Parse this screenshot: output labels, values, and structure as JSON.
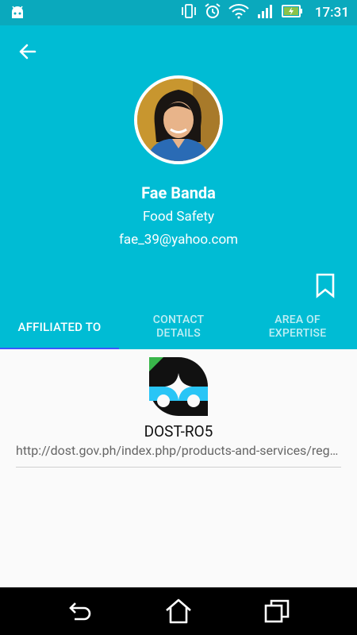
{
  "status_bar": {
    "time": "17:31",
    "icons": [
      "android-icon",
      "vibrate-icon",
      "alarm-icon",
      "wifi-icon",
      "signal-icon",
      "battery-charging-icon"
    ]
  },
  "profile": {
    "name": "Fae Banda",
    "department": "Food Safety",
    "email": "fae_39@yahoo.com"
  },
  "tabs": [
    {
      "label": "AFFILIATED TO",
      "active": true
    },
    {
      "label": "CONTACT\nDETAILS",
      "active": false
    },
    {
      "label": "AREA OF\nEXPERTISE",
      "active": false
    }
  ],
  "affiliation": {
    "name": "DOST-RO5",
    "url": "http://dost.gov.ph/index.php/products-and-services/regional-offices/"
  },
  "colors": {
    "header": "#00bcd4",
    "status_bar": "#0aa9bd",
    "tab_indicator": "#3b57ff",
    "logo_cyan": "#29c5f6",
    "logo_green": "#39b54a"
  }
}
